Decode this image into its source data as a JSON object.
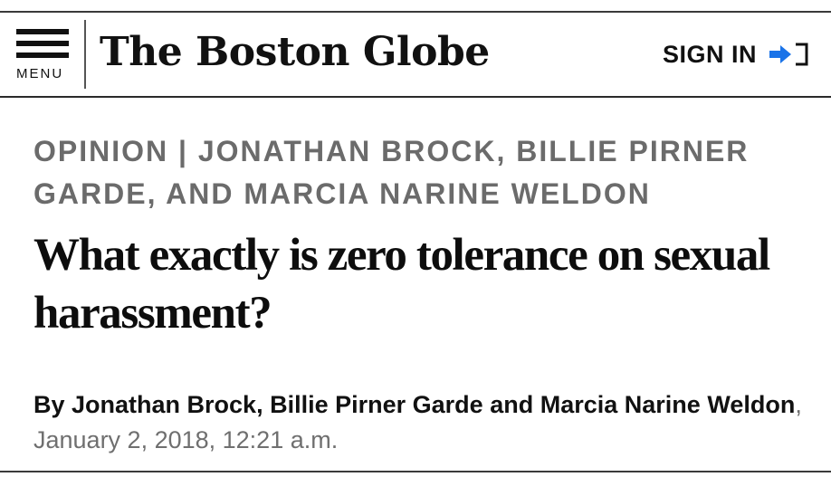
{
  "header": {
    "menu_label": "MENU",
    "logo_text": "The Boston Globe",
    "signin_label": "SIGN IN",
    "signin_icon": "login-arrow-icon",
    "accent_color": "#1a73e8"
  },
  "article": {
    "kicker": "OPINION | JONATHAN BROCK, BILLIE PIRNER GARDE, AND MARCIA NARINE WELDON",
    "headline": "What exactly is zero tolerance on sexual harassment?",
    "byline": {
      "prefix": "By",
      "authors": [
        "Jonathan Brock,",
        "Billie Pirner Garde",
        "and",
        "Marcia Narine Weldon"
      ],
      "date": ", January 2, 2018, 12:21 a.m."
    }
  }
}
